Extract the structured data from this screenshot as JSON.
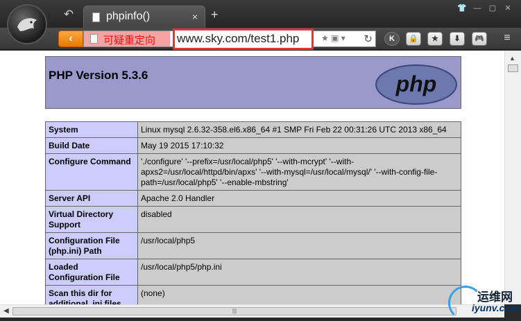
{
  "tab": {
    "title": "phpinfo()",
    "close": "×",
    "new": "+"
  },
  "toolbar": {
    "back": "‹",
    "redirect_label": "可疑重定向",
    "url": "www.sky.com/test1.php",
    "addr_tools": "★ ▣ ▾",
    "reload": "↻",
    "buttons": [
      "K",
      "🔒",
      "★",
      "⬇",
      "🎮"
    ]
  },
  "window_controls": [
    "👕",
    "—",
    "▢",
    "✕"
  ],
  "header": {
    "version": "PHP Version 5.3.6",
    "logo_text": "php"
  },
  "rows": [
    {
      "label": "System",
      "value": "Linux mysql 2.6.32-358.el6.x86_64 #1 SMP Fri Feb 22 00:31:26 UTC 2013 x86_64"
    },
    {
      "label": "Build Date",
      "value": "May 19 2015 17:10:32"
    },
    {
      "label": "Configure Command",
      "value": "'./configure' '--prefix=/usr/local/php5' '--with-mcrypt' '--with-apxs2=/usr/local/httpd/bin/apxs' '--with-mysql=/usr/local/mysql/' '--with-config-file-path=/usr/local/php5' '--enable-mbstring'"
    },
    {
      "label": "Server API",
      "value": "Apache 2.0 Handler"
    },
    {
      "label": "Virtual Directory Support",
      "value": "disabled"
    },
    {
      "label": "Configuration File (php.ini) Path",
      "value": "/usr/local/php5"
    },
    {
      "label": "Loaded Configuration File",
      "value": "/usr/local/php5/php.ini"
    },
    {
      "label": "Scan this dir for additional .ini files",
      "value": "(none)"
    }
  ],
  "watermark": {
    "line1": "运维网",
    "line2": "iyunv.com"
  },
  "colors": {
    "accent_orange": "#f08a00",
    "redirect_red": "#e63333",
    "php_header": "#9999cc",
    "label_cell": "#ccccff",
    "value_cell": "#cccccc"
  }
}
